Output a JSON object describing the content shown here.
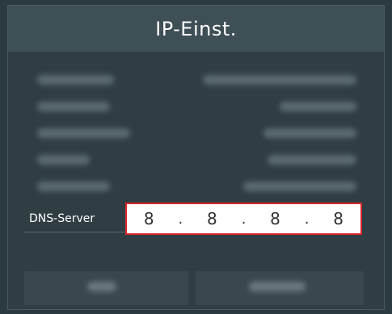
{
  "dialog": {
    "title": "IP-Einst."
  },
  "dns": {
    "label": "DNS-Server",
    "octets": [
      "8",
      "8",
      "8",
      "8"
    ],
    "separator": "."
  },
  "colors": {
    "background": "#2b3a40",
    "title_bar": "#3e4f55",
    "focus_border": "#d9262b",
    "field_bg": "#ffffff"
  }
}
